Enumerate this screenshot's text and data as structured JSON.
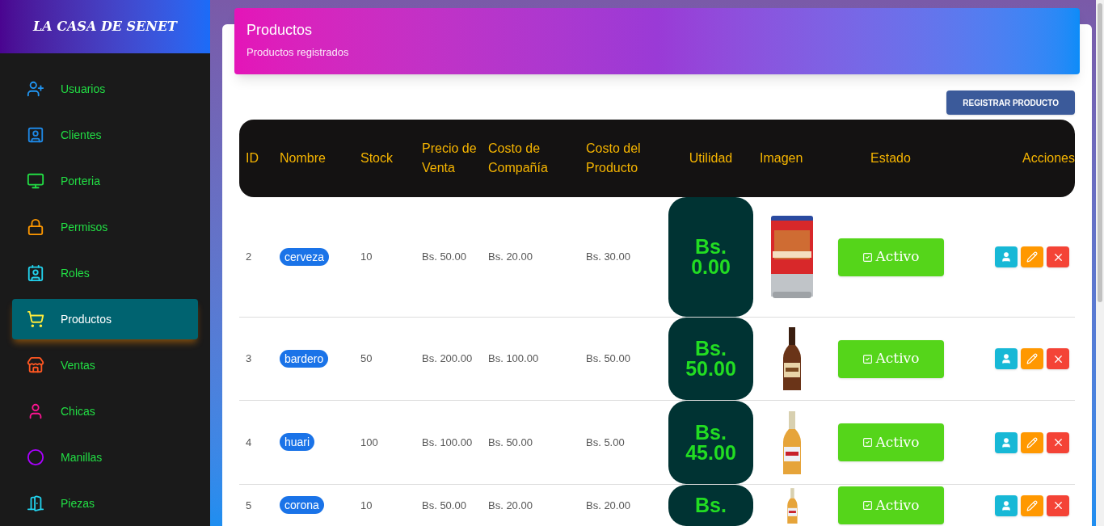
{
  "brand": "LA CASA DE SENET",
  "sidebar": {
    "items": [
      {
        "label": "Usuarios",
        "selected": false
      },
      {
        "label": "Clientes",
        "selected": false
      },
      {
        "label": "Porteria",
        "selected": false
      },
      {
        "label": "Permisos",
        "selected": false
      },
      {
        "label": "Roles",
        "selected": false
      },
      {
        "label": "Productos",
        "selected": true
      },
      {
        "label": "Ventas",
        "selected": false
      },
      {
        "label": "Chicas",
        "selected": false
      },
      {
        "label": "Manillas",
        "selected": false
      },
      {
        "label": "Piezas",
        "selected": false
      }
    ]
  },
  "card": {
    "title": "Productos",
    "subtitle": "Productos registrados",
    "register_button": "REGISTRAR PRODUCTO"
  },
  "table": {
    "columns": [
      "ID",
      "Nombre",
      "Stock",
      "Precio de Venta",
      "Costo de Compañía",
      "Costo del Producto",
      "Utilidad",
      "Imagen",
      "Estado",
      "Acciones"
    ],
    "rows": [
      {
        "id": "2",
        "name": "cerveza",
        "stock": "10",
        "price": "Bs. 50.00",
        "company_cost": "Bs. 20.00",
        "product_cost": "Bs. 30.00",
        "profit": "Bs. 0.00",
        "status": "Activo"
      },
      {
        "id": "3",
        "name": "bardero",
        "stock": "50",
        "price": "Bs. 200.00",
        "company_cost": "Bs. 100.00",
        "product_cost": "Bs. 50.00",
        "profit": "Bs. 50.00",
        "status": "Activo"
      },
      {
        "id": "4",
        "name": "huari",
        "stock": "100",
        "price": "Bs. 100.00",
        "company_cost": "Bs. 50.00",
        "product_cost": "Bs. 5.00",
        "profit": "Bs. 45.00",
        "status": "Activo"
      },
      {
        "id": "5",
        "name": "corona",
        "stock": "10",
        "price": "Bs. 50.00",
        "company_cost": "Bs. 20.00",
        "product_cost": "Bs. 20.00",
        "profit": "Bs.",
        "status": "Activo"
      }
    ]
  }
}
